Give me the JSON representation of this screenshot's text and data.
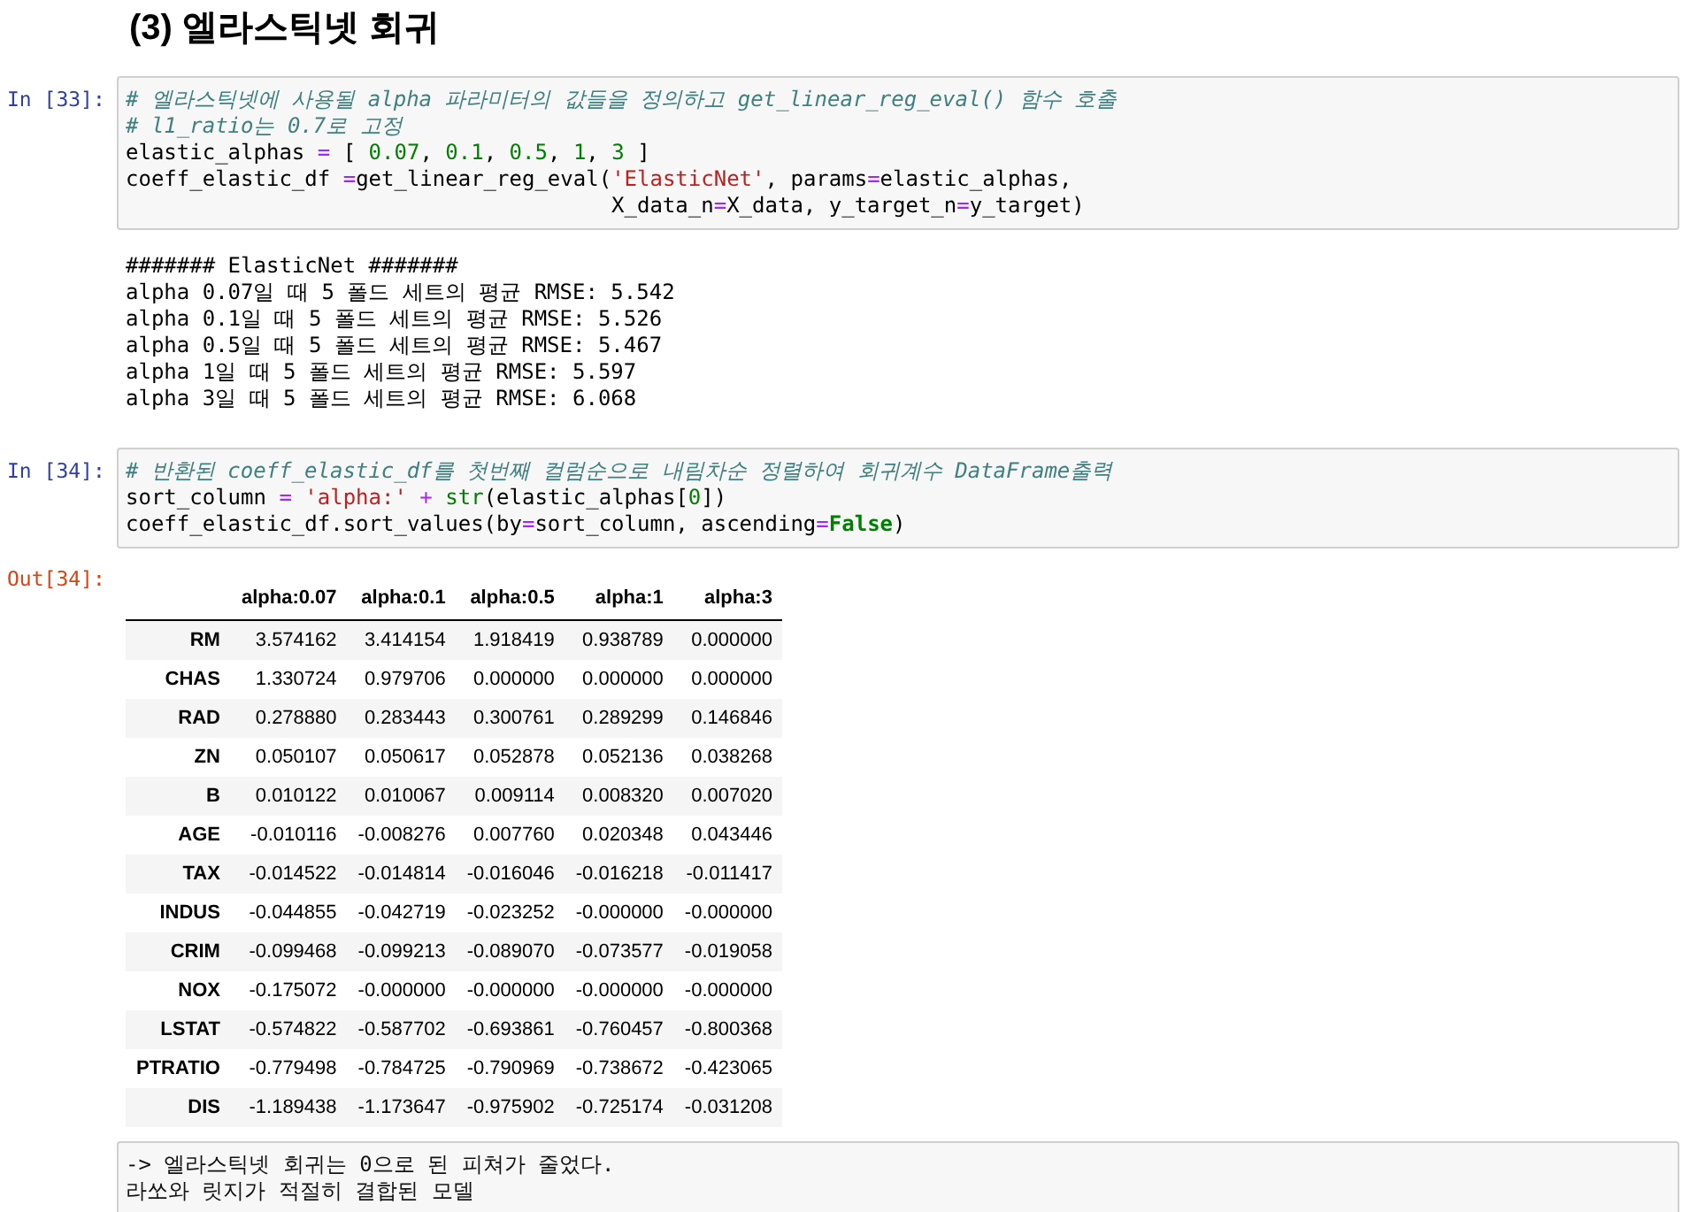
{
  "heading": "(3) 엘라스틱넷 회귀",
  "cells": [
    {
      "kind": "code",
      "prompt": "In [33]:",
      "lines": [
        [
          {
            "kind": "comment",
            "text": "# 엘라스틱넷에 사용될 alpha 파라미터의 값들을 정의하고 get_linear_reg_eval() 함수 호출"
          }
        ],
        [
          {
            "kind": "comment",
            "text": "# l1_ratio는 0.7로 고정"
          }
        ],
        [
          {
            "kind": "plain",
            "text": "elastic_alphas "
          },
          {
            "kind": "op",
            "text": "="
          },
          {
            "kind": "plain",
            "text": " [ "
          },
          {
            "kind": "number",
            "text": "0.07"
          },
          {
            "kind": "plain",
            "text": ", "
          },
          {
            "kind": "number",
            "text": "0.1"
          },
          {
            "kind": "plain",
            "text": ", "
          },
          {
            "kind": "number",
            "text": "0.5"
          },
          {
            "kind": "plain",
            "text": ", "
          },
          {
            "kind": "number",
            "text": "1"
          },
          {
            "kind": "plain",
            "text": ", "
          },
          {
            "kind": "number",
            "text": "3"
          },
          {
            "kind": "plain",
            "text": " ]"
          }
        ],
        [
          {
            "kind": "plain",
            "text": "coeff_elastic_df "
          },
          {
            "kind": "op",
            "text": "="
          },
          {
            "kind": "plain",
            "text": "get_linear_reg_eval("
          },
          {
            "kind": "string",
            "text": "'ElasticNet'"
          },
          {
            "kind": "plain",
            "text": ", params"
          },
          {
            "kind": "op",
            "text": "="
          },
          {
            "kind": "plain",
            "text": "elastic_alphas,"
          }
        ],
        [
          {
            "kind": "plain",
            "text": "                                      X_data_n"
          },
          {
            "kind": "op",
            "text": "="
          },
          {
            "kind": "plain",
            "text": "X_data, y_target_n"
          },
          {
            "kind": "op",
            "text": "="
          },
          {
            "kind": "plain",
            "text": "y_target)"
          }
        ]
      ]
    },
    {
      "kind": "stream",
      "lines": [
        "####### ElasticNet #######",
        "alpha 0.07일 때 5 폴드 세트의 평균 RMSE: 5.542",
        "alpha 0.1일 때 5 폴드 세트의 평균 RMSE: 5.526",
        "alpha 0.5일 때 5 폴드 세트의 평균 RMSE: 5.467",
        "alpha 1일 때 5 폴드 세트의 평균 RMSE: 5.597",
        "alpha 3일 때 5 폴드 세트의 평균 RMSE: 6.068"
      ]
    },
    {
      "kind": "code",
      "prompt": "In [34]:",
      "lines": [
        [
          {
            "kind": "comment",
            "text": "# 반환된 coeff_elastic_df를 첫번째 컬럼순으로 내림차순 정렬하여 회귀계수 DataFrame출력"
          }
        ],
        [
          {
            "kind": "plain",
            "text": "sort_column "
          },
          {
            "kind": "op",
            "text": "= "
          },
          {
            "kind": "string",
            "text": "'alpha:'"
          },
          {
            "kind": "op",
            "text": " + "
          },
          {
            "kind": "builtin",
            "text": "str"
          },
          {
            "kind": "plain",
            "text": "(elastic_alphas["
          },
          {
            "kind": "number",
            "text": "0"
          },
          {
            "kind": "plain",
            "text": "])"
          }
        ],
        [
          {
            "kind": "plain",
            "text": "coeff_elastic_df.sort_values(by"
          },
          {
            "kind": "op",
            "text": "="
          },
          {
            "kind": "plain",
            "text": "sort_column, ascending"
          },
          {
            "kind": "op",
            "text": "="
          },
          {
            "kind": "keyword",
            "text": "False"
          },
          {
            "kind": "plain",
            "text": ")"
          }
        ]
      ]
    },
    {
      "kind": "table",
      "prompt": "Out[34]:",
      "columns": [
        "alpha:0.07",
        "alpha:0.1",
        "alpha:0.5",
        "alpha:1",
        "alpha:3"
      ],
      "rows": [
        {
          "index": "RM",
          "values": [
            "3.574162",
            "3.414154",
            "1.918419",
            "0.938789",
            "0.000000"
          ]
        },
        {
          "index": "CHAS",
          "values": [
            "1.330724",
            "0.979706",
            "0.000000",
            "0.000000",
            "0.000000"
          ]
        },
        {
          "index": "RAD",
          "values": [
            "0.278880",
            "0.283443",
            "0.300761",
            "0.289299",
            "0.146846"
          ]
        },
        {
          "index": "ZN",
          "values": [
            "0.050107",
            "0.050617",
            "0.052878",
            "0.052136",
            "0.038268"
          ]
        },
        {
          "index": "B",
          "values": [
            "0.010122",
            "0.010067",
            "0.009114",
            "0.008320",
            "0.007020"
          ]
        },
        {
          "index": "AGE",
          "values": [
            "-0.010116",
            "-0.008276",
            "0.007760",
            "0.020348",
            "0.043446"
          ]
        },
        {
          "index": "TAX",
          "values": [
            "-0.014522",
            "-0.014814",
            "-0.016046",
            "-0.016218",
            "-0.011417"
          ]
        },
        {
          "index": "INDUS",
          "values": [
            "-0.044855",
            "-0.042719",
            "-0.023252",
            "-0.000000",
            "-0.000000"
          ]
        },
        {
          "index": "CRIM",
          "values": [
            "-0.099468",
            "-0.099213",
            "-0.089070",
            "-0.073577",
            "-0.019058"
          ]
        },
        {
          "index": "NOX",
          "values": [
            "-0.175072",
            "-0.000000",
            "-0.000000",
            "-0.000000",
            "-0.000000"
          ]
        },
        {
          "index": "LSTAT",
          "values": [
            "-0.574822",
            "-0.587702",
            "-0.693861",
            "-0.760457",
            "-0.800368"
          ]
        },
        {
          "index": "PTRATIO",
          "values": [
            "-0.779498",
            "-0.784725",
            "-0.790969",
            "-0.738672",
            "-0.423065"
          ]
        },
        {
          "index": "DIS",
          "values": [
            "-1.189438",
            "-1.173647",
            "-0.975902",
            "-0.725174",
            "-0.031208"
          ]
        }
      ]
    },
    {
      "kind": "raw",
      "lines": [
        "-> 엘라스틱넷 회귀는 0으로 된 피쳐가 줄었다.",
        "라쏘와 릿지가 적절히 결합된 모델"
      ]
    }
  ]
}
